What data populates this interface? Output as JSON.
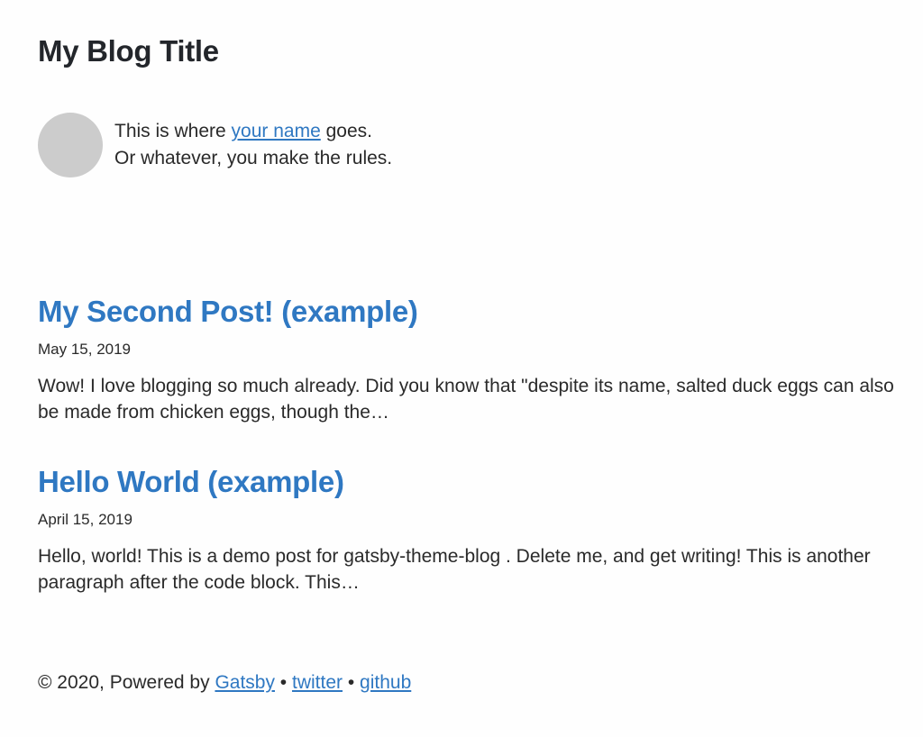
{
  "header": {
    "title": "My Blog Title"
  },
  "bio": {
    "line1_prefix": "This is where ",
    "name_link": "your name",
    "line1_suffix": " goes.",
    "line2": "Or whatever, you make the rules."
  },
  "posts": [
    {
      "title": "My Second Post! (example)",
      "date": "May 15, 2019",
      "excerpt": "Wow! I love blogging so much already. Did you know that \"despite its name, salted duck eggs can also be made from chicken eggs, though the…"
    },
    {
      "title": "Hello World (example)",
      "date": "April 15, 2019",
      "excerpt": "Hello, world! This is a demo post for gatsby-theme-blog . Delete me, and get writing! This is another paragraph after the code block. This…"
    }
  ],
  "footer": {
    "prefix": "© 2020, Powered by ",
    "gatsby_link": "Gatsby",
    "separator1": " • ",
    "twitter_link": "twitter",
    "separator2": " • ",
    "github_link": "github"
  },
  "colors": {
    "link": "#2f78c2",
    "text": "#2a2a2a",
    "avatar": "#cccccc",
    "background": "#fefefe"
  }
}
